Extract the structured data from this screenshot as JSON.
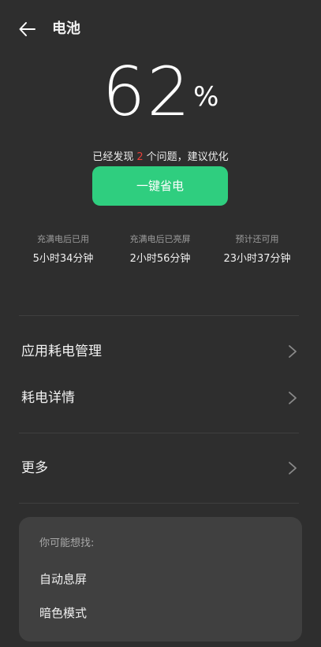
{
  "header": {
    "title": "电池"
  },
  "battery": {
    "percent": "62",
    "percent_sign": "%"
  },
  "issues": {
    "prefix": "已经发现",
    "count": "2",
    "suffix": "个问题，建议优化"
  },
  "optimize_button": {
    "label": "一键省电"
  },
  "stats": [
    {
      "label": "充满电后已用",
      "value": "5小时34分钟"
    },
    {
      "label": "充满电后已亮屏",
      "value": "2小时56分钟"
    },
    {
      "label": "预计还可用",
      "value": "23小时37分钟"
    }
  ],
  "menu": [
    {
      "label": "应用耗电管理"
    },
    {
      "label": "耗电详情"
    },
    {
      "label": "更多"
    }
  ],
  "suggestions": {
    "title": "你可能想找:",
    "items": [
      {
        "label": "自动息屏"
      },
      {
        "label": "暗色模式"
      }
    ]
  },
  "colors": {
    "background": "#2e2e2e",
    "accent_green": "#2fce7f",
    "issue_red": "#e8403a",
    "card": "#404040"
  },
  "icons": {
    "back": "arrow-left-icon",
    "row_chevron": "chevron-right-icon"
  }
}
